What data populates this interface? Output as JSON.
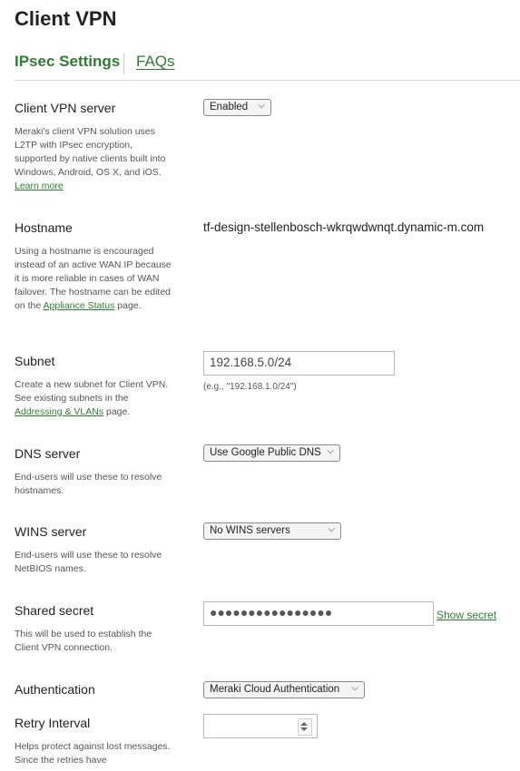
{
  "page": {
    "title": "Client VPN"
  },
  "tabs": {
    "active": "IPsec Settings",
    "other": "FAQs"
  },
  "client_vpn_server": {
    "label": "Client VPN server",
    "value": "Enabled",
    "desc": "Meraki's client VPN solution uses L2TP with IPsec encryption, supported by native clients built into Windows, Android, OS X, and iOS.",
    "link": "Learn more"
  },
  "hostname": {
    "label": "Hostname",
    "value": "tf-design-stellenbosch-wkrqwdwnqt.dynamic-m.com",
    "desc": "Using a hostname is encouraged instead of an active WAN IP because it is more reliable in cases of WAN failover. The hostname can be edited on the",
    "link": "Appliance Status",
    "desc_end": "page."
  },
  "subnet": {
    "label": "Subnet",
    "value": "192.168.5.0/24",
    "hint": "(e.g., \"192.168.1.0/24\")",
    "desc": "Create a new subnet for Client VPN. See existing subnets in the",
    "link": "Addressing & VLANs",
    "desc_end": "page."
  },
  "dns_server": {
    "label": "DNS server",
    "value": "Use Google Public DNS",
    "desc": "End-users will use these to resolve hostnames."
  },
  "wins_server": {
    "label": "WINS server",
    "value": "No WINS servers",
    "desc": "End-users will use these to resolve NetBIOS names."
  },
  "shared_secret": {
    "label": "Shared secret",
    "value": "●●●●●●●●●●●●●●●●",
    "show": "Show secret",
    "desc": "This will be used to establish the Client VPN connection."
  },
  "authentication": {
    "label": "Authentication",
    "value": "Meraki Cloud Authentication"
  },
  "retry_interval": {
    "label": "Retry Interval",
    "desc": "Helps protect against lost messages. Since the retries have"
  }
}
